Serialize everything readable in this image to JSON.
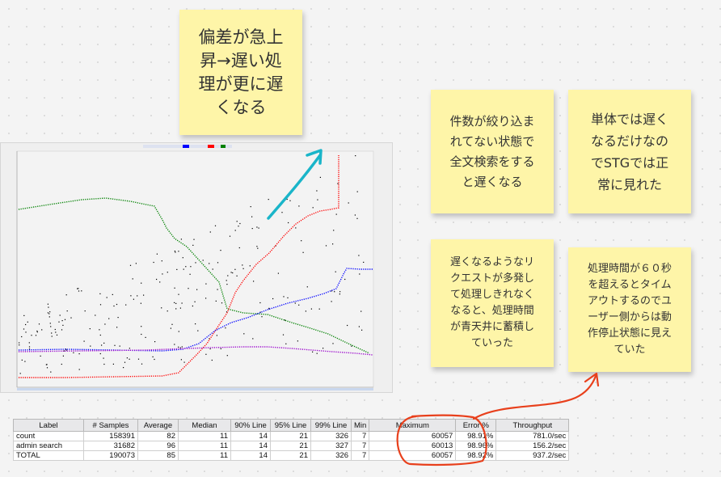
{
  "notes": {
    "deviation": "偏差が急上\n昇→遅い処\n理が更に遅\nくなる",
    "fulltext": "件数が絞り込ま\nれてない状態で\n全文検索をする\nと遅くなる",
    "single": "単体では遅く\nなるだけなの\nでSTGでは正\n常に見れた",
    "accumulate": "遅くなるようなリ\nクエストが多発し\nて処理しきれなく\nなると、処理時間\nが青天井に蓄積し\nていった",
    "timeout": "処理時間が６０秒\nを超えるとタイム\nアウトするのでユ\nーザー側からは動\n作停止状態に見え\nていた"
  },
  "results_table": {
    "headers": [
      "Label",
      "# Samples",
      "Average",
      "Median",
      "90% Line",
      "95% Line",
      "99% Line",
      "Min",
      "Maximum",
      "Error %",
      "Throughput"
    ],
    "rows": [
      {
        "label": "count",
        "samples": "158391",
        "average": "82",
        "median": "11",
        "p90": "14",
        "p95": "21",
        "p99": "326",
        "min": "7",
        "max": "60057",
        "error": "98.91%",
        "throughput": "781.0/sec"
      },
      {
        "label": "admin search",
        "samples": "31682",
        "average": "96",
        "median": "11",
        "p90": "14",
        "p95": "21",
        "p99": "327",
        "min": "7",
        "max": "60013",
        "error": "98.96%",
        "throughput": "156.2/sec"
      },
      {
        "label": "TOTAL",
        "samples": "190073",
        "average": "85",
        "median": "11",
        "p90": "14",
        "p95": "21",
        "p99": "326",
        "min": "7",
        "max": "60057",
        "error": "98.92%",
        "throughput": "937.2/sec"
      }
    ]
  },
  "colors": {
    "note_bg": "#fef5a8",
    "average_line": "#ff0000",
    "median_line": "#0000ff",
    "deviation_line": "#008000",
    "throughput_line": "#9900cc",
    "data_points": "#000000",
    "cyan_arrow": "#1ab5c9",
    "red_annotation": "#e8401c"
  },
  "icons": {
    "cyan_arrow": "hand-drawn-arrow-icon",
    "red_loop": "hand-drawn-circle-arrow-icon"
  }
}
